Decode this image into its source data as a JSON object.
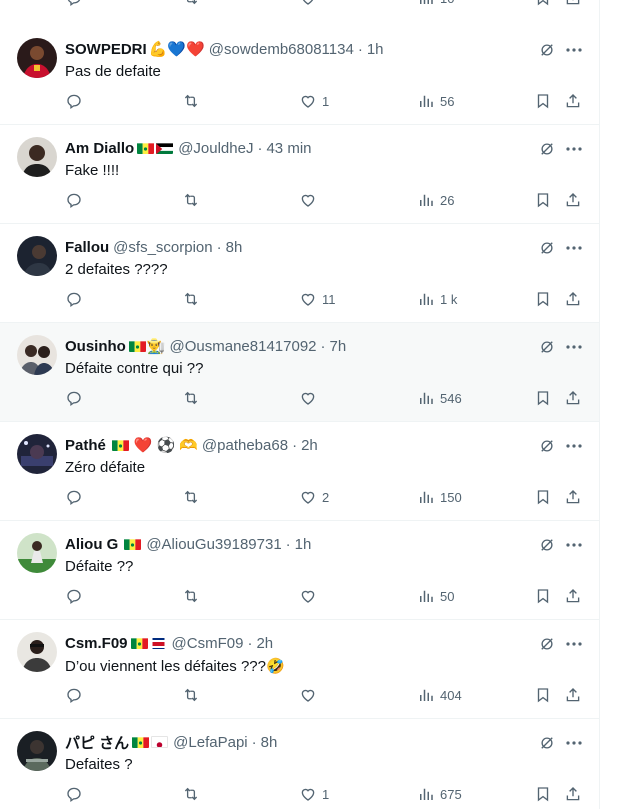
{
  "top_partial": {
    "views": "10"
  },
  "tweets": [
    {
      "name": "SOWPEDRI",
      "handle": "@sowdemb68081134",
      "time": "1h",
      "text": "Pas de defaite",
      "replies": "",
      "retweets": "",
      "likes": "1",
      "views": "56",
      "emojis": [
        "💪",
        "💙",
        "❤️"
      ]
    },
    {
      "name": "Am Diallo",
      "handle": "@JouldheJ",
      "time": "43 min",
      "text": "Fake !!!!",
      "replies": "",
      "retweets": "",
      "likes": "",
      "views": "26",
      "flags": [
        "senegal",
        "palestine"
      ]
    },
    {
      "name": "Fallou",
      "handle": "@sfs_scorpion",
      "time": "8h",
      "text": "2 defaites ????",
      "replies": "",
      "retweets": "",
      "likes": "11",
      "views": "1 k"
    },
    {
      "name": "Ousinho",
      "handle": "@Ousmane81417092",
      "time": "7h",
      "text": "Défaite contre qui ??",
      "replies": "",
      "retweets": "",
      "likes": "",
      "views": "546",
      "flags": [
        "senegal"
      ],
      "emojis": [
        "👨‍🌾"
      ]
    },
    {
      "name": "Pathé",
      "handle": "@patheba68",
      "time": "2h",
      "text": "Zéro défaite",
      "replies": "",
      "retweets": "",
      "likes": "2",
      "views": "150",
      "flags": [
        "senegal"
      ],
      "emojis": [
        "❤️",
        "⚽",
        "🫶"
      ]
    },
    {
      "name": "Aliou G",
      "handle": "@AliouGu39189731",
      "time": "1h",
      "text": "Défaite ??",
      "replies": "",
      "retweets": "",
      "likes": "",
      "views": "50",
      "flags": [
        "senegal"
      ]
    },
    {
      "name": "Csm.F09",
      "handle": "@CsmF09",
      "time": "2h",
      "text": "D’ou viennent les défaites ???🤣",
      "replies": "",
      "retweets": "",
      "likes": "",
      "views": "404",
      "flags": [
        "senegal",
        "costa-rica"
      ]
    },
    {
      "name": "パピ さん",
      "handle": "@LefaPapi",
      "time": "8h",
      "text": "Defaites ?",
      "replies": "",
      "retweets": "",
      "likes": "1",
      "views": "675",
      "flags": [
        "senegal",
        "japan"
      ]
    }
  ],
  "colors": {
    "text": "#0f1419",
    "secondary": "#536471",
    "divider": "#eff3f4",
    "hover_bg": "#f7f9f9"
  },
  "icons": [
    "reply-icon",
    "retweet-icon",
    "like-icon",
    "views-icon",
    "bookmark-icon",
    "share-icon",
    "grok-icon",
    "more-icon"
  ]
}
